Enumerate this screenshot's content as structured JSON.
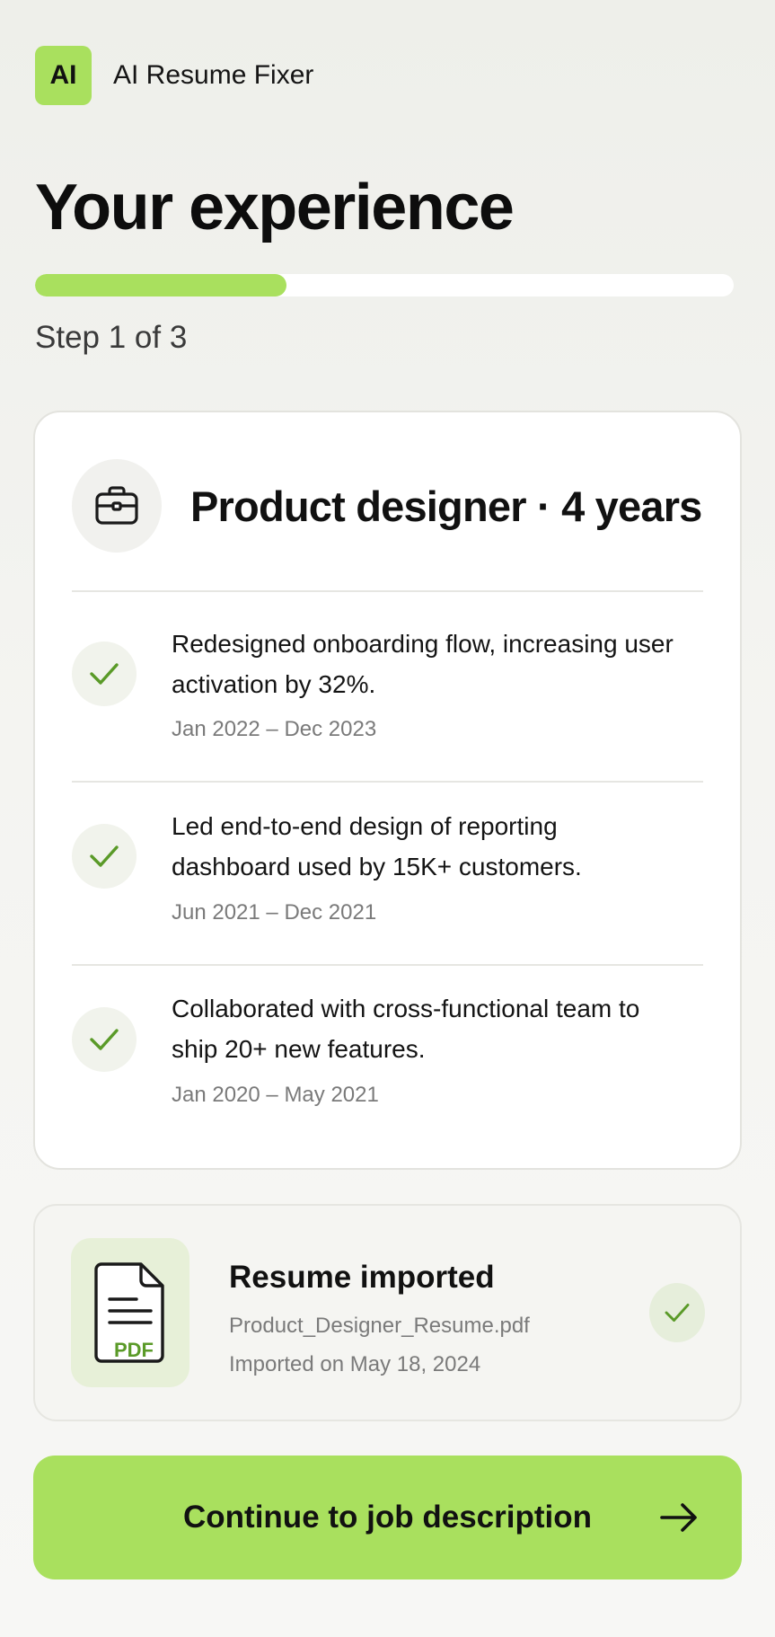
{
  "app": {
    "logo_text": "AI",
    "title": "AI Resume Fixer"
  },
  "page": {
    "title": "Your experience"
  },
  "progress": {
    "current_step": 1,
    "total_steps": 3,
    "fraction": 0.36,
    "label": "Step 1 of 3"
  },
  "experience": {
    "role_icon": "briefcase-icon",
    "role_title": "Product designer · 4 years",
    "items": [
      {
        "text": "Redesigned onboarding flow, increasing user activation by 32%.",
        "date": "Jan 2022 – Dec 2023",
        "icon": "check-icon"
      },
      {
        "text": "Led end-to-end design of reporting dashboard used by 15K+ customers.",
        "date": "Jun 2021 – Dec 2021",
        "icon": "check-icon"
      },
      {
        "text": "Collaborated with cross-functional team to ship 20+ new features.",
        "date": "Jan 2020 – May 2021",
        "icon": "check-icon"
      }
    ]
  },
  "import": {
    "file_icon": "pdf-file-icon",
    "file_icon_label": "PDF",
    "title": "Resume imported",
    "filename": "Product_Designer_Resume.pdf",
    "date": "Imported on May 18, 2024",
    "status_icon": "check-icon"
  },
  "cta": {
    "label": "Continue to job description",
    "icon": "arrow-right-icon"
  },
  "colors": {
    "accent": "#a9e05e",
    "check": "#5a9a28",
    "text": "#111111",
    "muted": "#7a7a7a"
  }
}
